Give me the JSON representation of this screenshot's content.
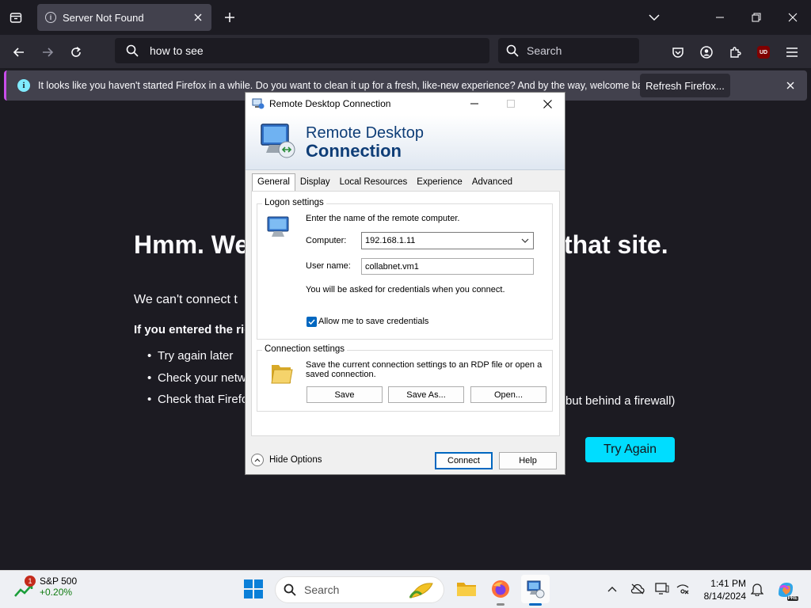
{
  "browser": {
    "tab": {
      "title": "Server Not Found"
    },
    "url": "how to see",
    "search_placeholder": "Search",
    "notification": {
      "text": "It looks like you haven't started Firefox in a while. Do you want to clean it up for a fresh, like-new experience? And by the way, welcome back!",
      "button": "Refresh Firefox..."
    },
    "ublock_label": "UD"
  },
  "error_page": {
    "title_left": "Hmm. We",
    "title_right": "that site.",
    "line1": "We can't connect t",
    "line2": "If you entered the rig",
    "bullets": [
      "Try again later",
      "Check your netwo",
      "Check that Firefo"
    ],
    "bullet3_tail": "but behind a firewall)",
    "try_again": "Try Again"
  },
  "rdp": {
    "window_title": "Remote Desktop Connection",
    "banner_line1": "Remote Desktop",
    "banner_line2": "Connection",
    "tabs": [
      "General",
      "Display",
      "Local Resources",
      "Experience",
      "Advanced"
    ],
    "logon": {
      "group_label": "Logon settings",
      "instruction": "Enter the name of the remote computer.",
      "computer_label": "Computer:",
      "computer_value": "192.168.1.11",
      "username_label": "User name:",
      "username_value": "collabnet.vm1",
      "credentials_note": "You will be asked for credentials when you connect.",
      "allow_save_label": "Allow me to save credentials",
      "allow_save_checked": true
    },
    "connection": {
      "group_label": "Connection settings",
      "description_line1": "Save the current connection settings to an RDP file or open a",
      "description_line2": "saved connection.",
      "save": "Save",
      "save_as": "Save As...",
      "open": "Open..."
    },
    "hide_options": "Hide Options",
    "connect": "Connect",
    "help": "Help"
  },
  "taskbar": {
    "widget": {
      "badge": "1",
      "name": "S&P 500",
      "value": "+0.20%"
    },
    "search_placeholder": "Search",
    "time": "1:41 PM",
    "date": "8/14/2024",
    "copilot_badge": "PRE"
  }
}
